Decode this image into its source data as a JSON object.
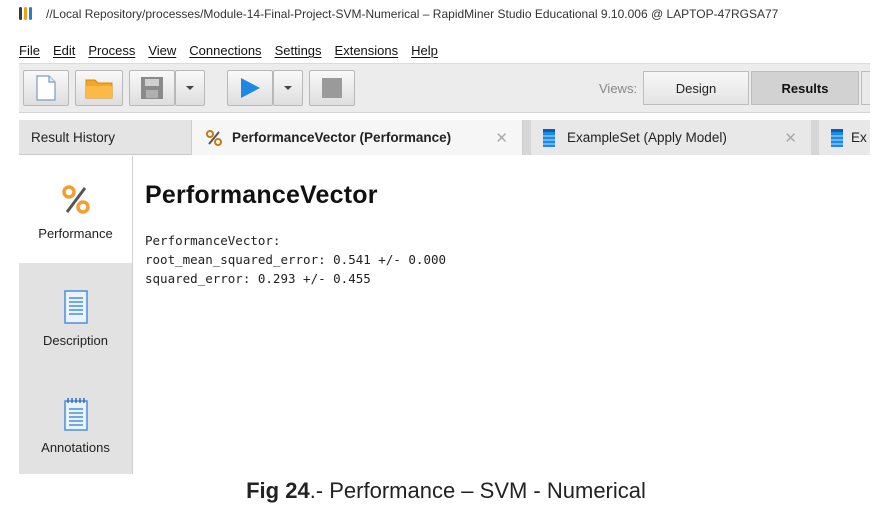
{
  "window": {
    "title": "//Local Repository/processes/Module-14-Final-Project-SVM-Numerical – RapidMiner Studio Educational 9.10.006 @ LAPTOP-47RGSA77"
  },
  "menu": {
    "items": [
      "File",
      "Edit",
      "Process",
      "View",
      "Connections",
      "Settings",
      "Extensions",
      "Help"
    ]
  },
  "toolbar": {
    "views_label": "Views:",
    "design_label": "Design",
    "results_label": "Results"
  },
  "tabs": [
    {
      "label": "Result History"
    },
    {
      "label": "PerformanceVector (Performance)"
    },
    {
      "label": "ExampleSet (Apply Model)"
    },
    {
      "label": "Ex"
    }
  ],
  "side_nav": [
    {
      "label": "Performance",
      "icon": "percent-icon"
    },
    {
      "label": "Description",
      "icon": "document-icon"
    },
    {
      "label": "Annotations",
      "icon": "notepad-icon"
    }
  ],
  "main": {
    "heading": "PerformanceVector",
    "lines": [
      "PerformanceVector:",
      "root_mean_squared_error: 0.541 +/- 0.000",
      "squared_error: 0.293 +/- 0.455"
    ]
  },
  "caption": {
    "bold": "Fig 24",
    "rest": ".- Performance – SVM - Numerical"
  },
  "colors": {
    "accent_blue": "#1e88e5",
    "folder_orange": "#f5a623",
    "percent_orange": "#f0a030"
  }
}
